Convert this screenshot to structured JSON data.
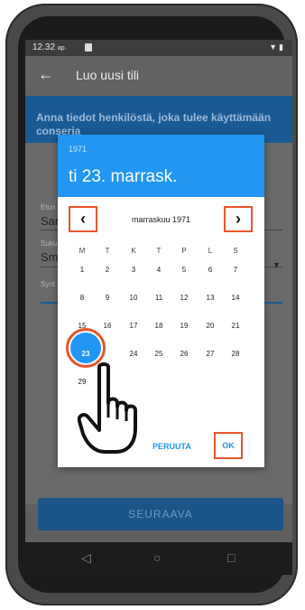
{
  "status_bar": {
    "time": "12.32",
    "ampm": "ap.",
    "icons": "▼▮"
  },
  "app_bar": {
    "back_icon": "←",
    "title": "Luo uusi tili"
  },
  "banner": {
    "text": "Anna tiedot henkilöstä, joka tulee käyttämään conseria"
  },
  "form": {
    "field1_label": "Etun",
    "field1_value": "Sar",
    "field2_label": "Suku",
    "field2_value": "Sm",
    "field3_label": "Synt",
    "dropdown_icon": "▼"
  },
  "next_button": {
    "label": "SEURAAVA"
  },
  "nav_bar": {
    "back": "◁",
    "home": "○",
    "recents": "□"
  },
  "date_picker": {
    "year": "1971",
    "selected_date": "ti 23. marrask.",
    "month_label": "marraskuu 1971",
    "prev_icon": "‹",
    "next_icon": "›",
    "weekdays": [
      "M",
      "T",
      "K",
      "T",
      "P",
      "L",
      "S"
    ],
    "days": [
      "1",
      "2",
      "3",
      "4",
      "5",
      "6",
      "7",
      "8",
      "9",
      "10",
      "11",
      "12",
      "13",
      "14",
      "15",
      "16",
      "17",
      "18",
      "19",
      "20",
      "21",
      "22",
      "23",
      "24",
      "25",
      "26",
      "27",
      "28",
      "29"
    ],
    "selected_day": "23",
    "cancel_label": "PERUUTA",
    "ok_label": "OK"
  },
  "colors": {
    "accent": "#2196f3",
    "highlight": "#e7552b",
    "banner": "#1a5a94"
  }
}
